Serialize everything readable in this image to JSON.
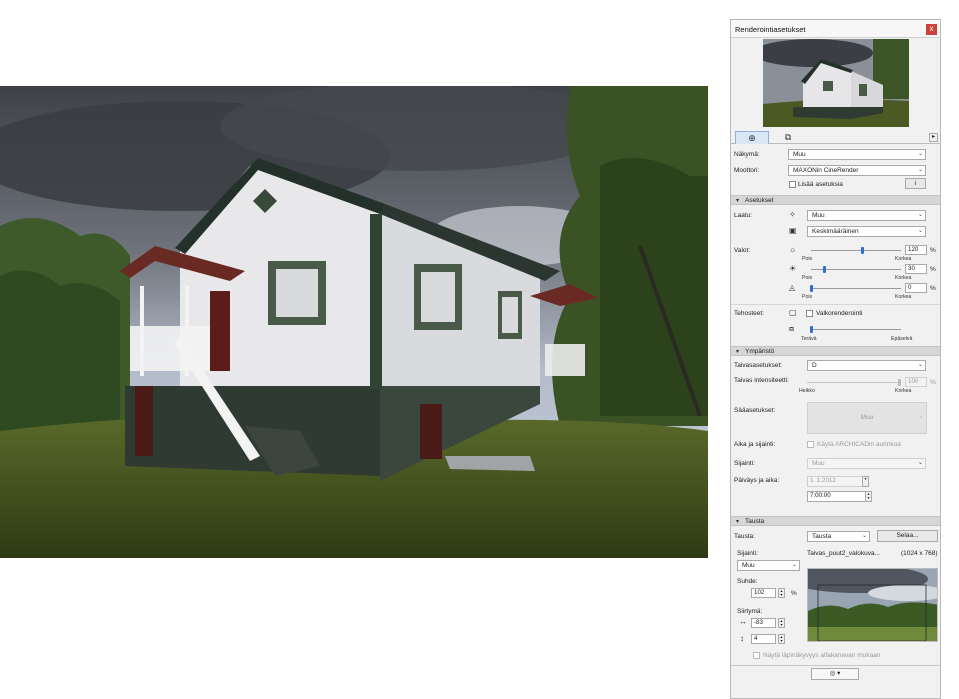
{
  "panel": {
    "title": "Renderointiasetukset",
    "close_label": "x",
    "tabs": [
      {
        "name": "view",
        "icon": "⊕"
      },
      {
        "name": "layout",
        "icon": "⧉"
      }
    ],
    "tab_arrow": "▸",
    "nakyma": {
      "label": "Näkymä:",
      "value": "Muu"
    },
    "moottori": {
      "label": "Moottori:",
      "value": "MAXONin CineRender"
    },
    "lisaa_asetuksia": "Lisää asetuksia",
    "lisaa_icon_label": "i",
    "asetukset": {
      "title": "Asetukset",
      "laatu_label": "Laatu:",
      "laatu_value": "Muu",
      "laatu2_value": "Keskimääräinen",
      "valot_label": "Valot:",
      "valot": [
        {
          "value": "120",
          "fraction": 0.57,
          "min_label": "Pois",
          "max_label": "Korkea"
        },
        {
          "value": "30",
          "fraction": 0.14,
          "min_label": "Pois",
          "max_label": "Korkea"
        },
        {
          "value": "0",
          "fraction": 0.0,
          "min_label": "Pois",
          "max_label": "Korkea"
        }
      ],
      "percent": "%",
      "tehosteet_label": "Tehosteet:",
      "valkorenderointi": "Valkorenderointi",
      "sharp_fraction": 0.0,
      "sharp_min": "Terävä",
      "sharp_max": "Epäselvä"
    },
    "ymparisto": {
      "title": "Ympäristö",
      "taivasasetukset_label": "Taivasasetukset:",
      "taivasasetukset_value": "D",
      "intensiteetti_label": "Taivas intensiteetti:",
      "intensiteetti_value": "100",
      "intensiteetti_fraction": 1.0,
      "heikko": "Heikko",
      "korkea": "Korkea",
      "saa_label": "Sääasetukset:",
      "saa_button": "Muu",
      "aika_label": "Aika ja sijainti:",
      "aika_checkbox": "Käytä ARCHICADin aurinkoa",
      "sijainti_label": "Sijainti:",
      "sijainti_value": "Muu",
      "paivays_label": "Päiväys ja aika:",
      "date_value": "1.  1.2012",
      "time_value": "7:00:00"
    },
    "tausta": {
      "title": "Tausta",
      "tausta_label": "Tausta:",
      "tausta_value": "Tausta",
      "selaa_button": "Selaa...",
      "sijainti_label": "Sijainti:",
      "sijainti_value": "Muu",
      "file_name": "Taivas_puut2_valokuva...",
      "file_size": "(1024 x 768)",
      "suhde_label": "Suhde:",
      "suhde_value": "102",
      "suhde_unit": "%",
      "siirtyma_label": "Siirtymä:",
      "siirtyma_x": "-83",
      "siirtyma_y": "4",
      "alpha_checkbox": "Näytä läpinäkyvyys alfakanavan mukaan"
    }
  },
  "colors": {
    "accent": "#2f6fd0",
    "close": "#c9423b",
    "tab_active": "#d9e6f6"
  }
}
